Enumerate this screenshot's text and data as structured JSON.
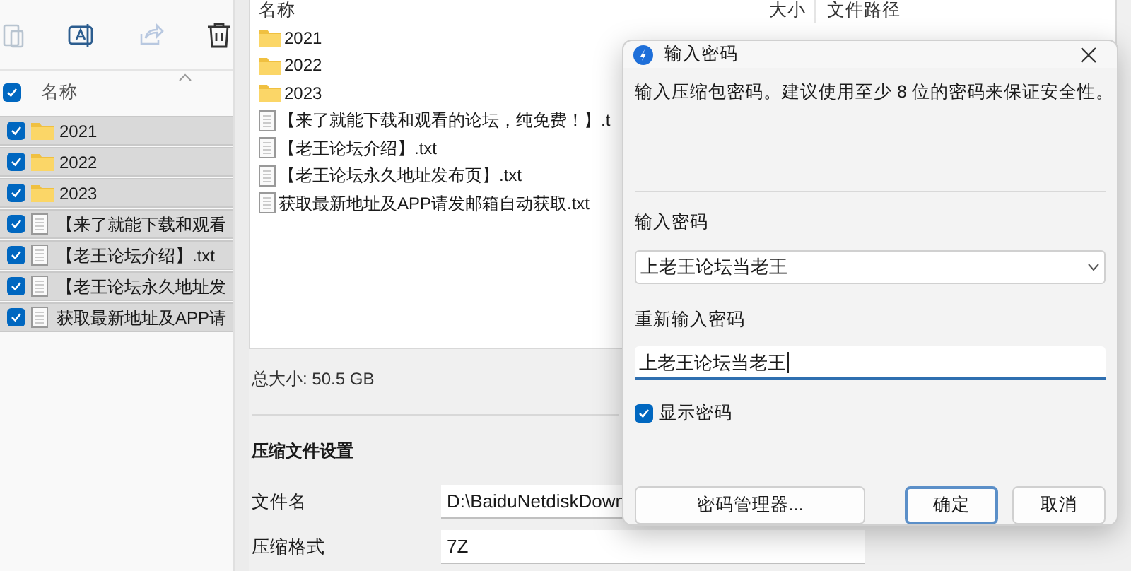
{
  "explorer": {
    "header": {
      "label": "名称",
      "checked": true
    },
    "rows": [
      {
        "kind": "folder",
        "name": "2021",
        "checked": true,
        "selected": true
      },
      {
        "kind": "folder",
        "name": "2022",
        "checked": true,
        "selected": true
      },
      {
        "kind": "folder",
        "name": "2023",
        "checked": true,
        "selected": true
      },
      {
        "kind": "file",
        "name": "【来了就能下载和观看",
        "checked": true,
        "selected": true
      },
      {
        "kind": "file",
        "name": "【老王论坛介绍】.txt",
        "checked": true,
        "selected": true
      },
      {
        "kind": "file",
        "name": "【老王论坛永久地址发",
        "checked": true,
        "selected": true
      },
      {
        "kind": "file",
        "name": "获取最新地址及APP请",
        "checked": true,
        "selected": true
      }
    ]
  },
  "archive_window": {
    "columns": [
      "名称",
      "大小",
      "文件路径"
    ],
    "rows": [
      {
        "kind": "folder",
        "name": "2021"
      },
      {
        "kind": "folder",
        "name": "2022"
      },
      {
        "kind": "folder",
        "name": "2023"
      },
      {
        "kind": "file",
        "name": "【来了就能下载和观看的论坛，纯免费！】.t"
      },
      {
        "kind": "file",
        "name": "【老王论坛介绍】.txt"
      },
      {
        "kind": "file",
        "name": "【老王论坛永久地址发布页】.txt"
      },
      {
        "kind": "file",
        "name": "获取最新地址及APP请发邮箱自动获取.txt"
      }
    ],
    "total_size": "总大小: 50.5 GB",
    "section_title": "压缩文件设置",
    "fields": [
      {
        "label": "文件名",
        "value": "D:\\BaiduNetdiskDown"
      },
      {
        "label": "压缩格式",
        "value": "7Z"
      }
    ]
  },
  "dialog": {
    "title": "输入密码",
    "description": "输入压缩包密码。建议使用至少 8 位的密码来保证安全性。",
    "password_label": "输入密码",
    "password_value": "上老王论坛当老王",
    "confirm_label": "重新输入密码",
    "confirm_value": "上老王论坛当老王",
    "show_password": {
      "label": "显示密码",
      "checked": true
    },
    "buttons": [
      {
        "label": "密码管理器...",
        "default": false
      },
      {
        "label": "确定",
        "default": true
      },
      {
        "label": "取消",
        "default": false
      }
    ]
  }
}
